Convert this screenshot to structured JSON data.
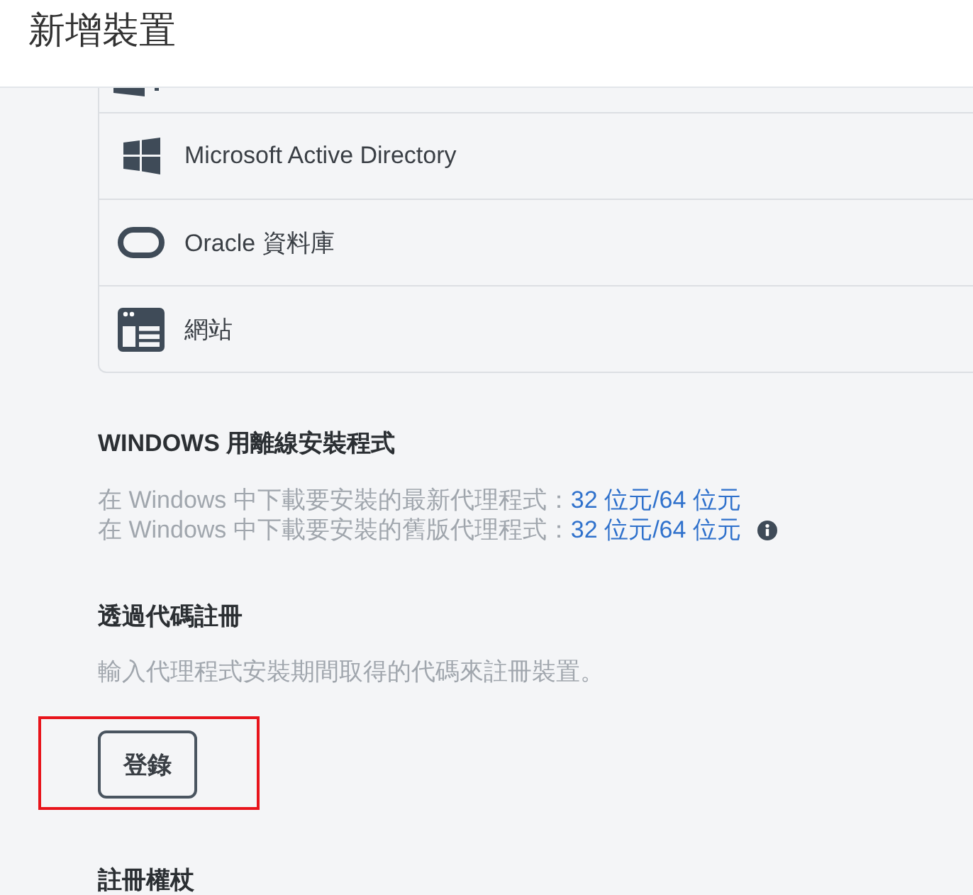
{
  "header": {
    "title": "新增裝置"
  },
  "device_types": [
    {
      "kind": "clipped"
    },
    {
      "kind": "windows",
      "label": "Microsoft Active Directory"
    },
    {
      "kind": "database",
      "label": "Oracle 資料庫"
    },
    {
      "kind": "website",
      "label": "網站"
    }
  ],
  "offline_installer": {
    "heading": "WINDOWS 用離線安裝程式",
    "lines": [
      {
        "text": "在 Windows 中下載要安裝的最新代理程式：",
        "links": [
          {
            "label": "32 位元"
          },
          {
            "label": "64 位元"
          }
        ],
        "separator": "/",
        "info": false
      },
      {
        "text": "在 Windows 中下載要安裝的舊版代理程式：",
        "links": [
          {
            "label": "32 位元"
          },
          {
            "label": "64 位元"
          }
        ],
        "separator": "/",
        "info": true
      }
    ]
  },
  "register_by_code": {
    "heading": "透過代碼註冊",
    "description": "輸入代理程式安裝期間取得的代碼來註冊裝置。",
    "button": {
      "label": "登錄",
      "highlighted": true
    }
  },
  "registration_token": {
    "heading": "註冊權杖"
  }
}
